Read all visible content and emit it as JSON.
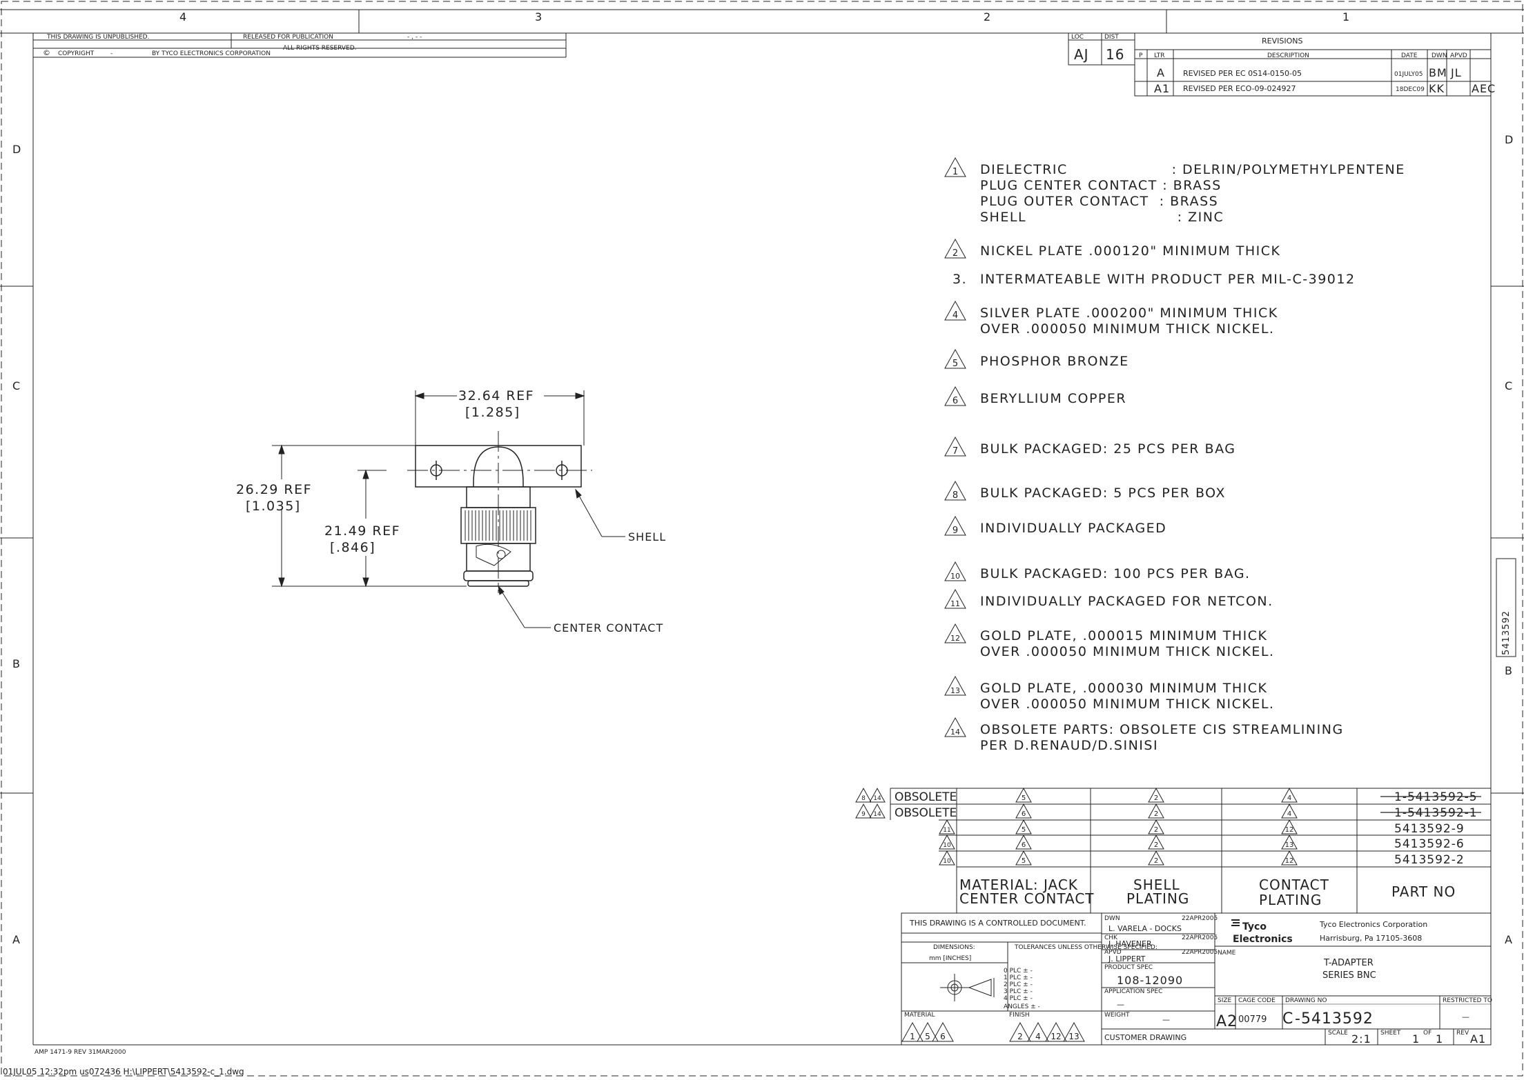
{
  "border": {
    "zones_top": [
      "4",
      "3",
      "2",
      "1"
    ],
    "zones_side": [
      "D",
      "C",
      "B",
      "A"
    ],
    "side_tab": "5413592"
  },
  "header": {
    "unpublished": "THIS DRAWING IS UNPUBLISHED.",
    "released": "RELEASED FOR PUBLICATION",
    "released_value": "- , -  -",
    "copyright_sym": "©",
    "copyright": "COPYRIGHT",
    "copyright_dash": "-",
    "by": "BY TYCO ELECTRONICS CORPORATION",
    "rights": "ALL RIGHTS RESERVED."
  },
  "loc_dist": {
    "loc_label": "LOC",
    "loc_value": "AJ",
    "dist_label": "DIST",
    "dist_value": "16"
  },
  "revisions": {
    "title": "REVISIONS",
    "headers": [
      "P",
      "LTR",
      "DESCRIPTION",
      "DATE",
      "DWN",
      "APVD"
    ],
    "rows": [
      {
        "ltr": "A",
        "desc": "REVISED PER EC 0S14-0150-05",
        "date": "01JULY05",
        "dwn": "BM",
        "apvd": "JL"
      },
      {
        "ltr": "A1",
        "desc": "REVISED PER ECO-09-024927",
        "date": "18DEC09",
        "dwn": "KK",
        "apvd": "AEC"
      }
    ]
  },
  "notes": [
    {
      "num": "1",
      "tri": true,
      "lines": [
        "DIELECTRIC                    : DELRIN/POLYMETHYLPENTENE",
        "PLUG CENTER CONTACT : BRASS",
        "PLUG OUTER CONTACT  : BRASS",
        "SHELL                             : ZINC"
      ]
    },
    {
      "num": "2",
      "tri": true,
      "lines": [
        "NICKEL PLATE .000120\" MINIMUM THICK"
      ]
    },
    {
      "num": "3.",
      "tri": false,
      "lines": [
        "INTERMATEABLE WITH PRODUCT PER MIL-C-39012"
      ]
    },
    {
      "num": "4",
      "tri": true,
      "lines": [
        "SILVER PLATE .000200\" MINIMUM THICK",
        "OVER .000050 MINIMUM THICK NICKEL."
      ]
    },
    {
      "num": "5",
      "tri": true,
      "lines": [
        "PHOSPHOR BRONZE"
      ]
    },
    {
      "num": "6",
      "tri": true,
      "lines": [
        "BERYLLIUM COPPER"
      ]
    },
    {
      "num": "7",
      "tri": true,
      "lines": [
        "BULK PACKAGED: 25 PCS PER BAG"
      ]
    },
    {
      "num": "8",
      "tri": true,
      "lines": [
        "BULK PACKAGED: 5 PCS PER BOX"
      ]
    },
    {
      "num": "9",
      "tri": true,
      "lines": [
        "INDIVIDUALLY PACKAGED"
      ]
    },
    {
      "num": "10",
      "tri": true,
      "lines": [
        "BULK PACKAGED: 100 PCS PER BAG."
      ]
    },
    {
      "num": "11",
      "tri": true,
      "lines": [
        "INDIVIDUALLY PACKAGED FOR NETCON."
      ]
    },
    {
      "num": "12",
      "tri": true,
      "lines": [
        "GOLD PLATE, .000015 MINIMUM THICK",
        "OVER .000050 MINIMUM THICK NICKEL."
      ]
    },
    {
      "num": "13",
      "tri": true,
      "lines": [
        "GOLD PLATE, .000030 MINIMUM THICK",
        "OVER .000050 MINIMUM THICK NICKEL."
      ]
    },
    {
      "num": "14",
      "tri": true,
      "lines": [
        "OBSOLETE PARTS: OBSOLETE CIS STREAMLINING",
        "PER D.RENAUD/D.SINISI"
      ]
    }
  ],
  "drawing": {
    "width_dim": "32.64 REF",
    "width_dim_in": "[1.285]",
    "height_dim": "26.29 REF",
    "height_dim_in": "[1.035]",
    "height2_dim": "21.49 REF",
    "height2_dim_in": "[.846]",
    "shell_label": "SHELL",
    "center_label": "CENTER CONTACT"
  },
  "parts_table": {
    "headers": [
      "MATERIAL: JACK",
      "CENTER CONTACT",
      "SHELL",
      "PLATING",
      "CONTACT",
      "PLATING",
      "PART NO"
    ],
    "rows": [
      {
        "tags": [
          "8",
          "14"
        ],
        "label": "OBSOLETE",
        "mat": "5",
        "shell": "2",
        "plating": "4",
        "part": "1-5413592-5",
        "obsolete": true
      },
      {
        "tags": [
          "9",
          "14"
        ],
        "label": "OBSOLETE",
        "mat": "6",
        "shell": "2",
        "plating": "4",
        "part": "1-5413592-1",
        "obsolete": true
      },
      {
        "tags": [
          "11"
        ],
        "label": "",
        "mat": "5",
        "shell": "2",
        "plating": "12",
        "part": "5413592-9",
        "obsolete": false
      },
      {
        "tags": [
          "10"
        ],
        "label": "",
        "mat": "6",
        "shell": "2",
        "plating": "13",
        "part": "5413592-6",
        "obsolete": false
      },
      {
        "tags": [
          "10"
        ],
        "label": "",
        "mat": "5",
        "shell": "2",
        "plating": "12",
        "part": "5413592-2",
        "obsolete": false
      }
    ]
  },
  "title_block": {
    "controlled": "THIS DRAWING IS A CONTROLLED DOCUMENT.",
    "dimensions": "DIMENSIONS:",
    "dim_units": "mm [INCHES]",
    "tolerances": "TOLERANCES UNLESS OTHERWISE SPECIFIED:",
    "tol_rows": [
      "0 PLC    ±  -",
      "1 PLC    ±  -",
      "2 PLC    ±  -",
      "3 PLC    ±  -",
      "4 PLC    ±  -",
      "ANGLES          ±  -"
    ],
    "material_label": "MATERIAL",
    "material_values": [
      "1",
      "5",
      "6"
    ],
    "finish_label": "FINISH",
    "finish_values": [
      "2",
      "4",
      "12",
      "13"
    ],
    "dwn_label": "DWN",
    "dwn_name": "L. VARELA - DOCKS",
    "dwn_date": "22APR2005",
    "chk_label": "CHK",
    "chk_name": "J. HAVENER",
    "chk_date": "22APR2005",
    "apvd_label": "APVD",
    "apvd_name": "J. LIPPERT",
    "apvd_date": "22APR2005",
    "product_spec_label": "PRODUCT SPEC",
    "product_spec": "108-12090",
    "app_spec_label": "APPLICATION SPEC",
    "app_spec": "—",
    "weight_label": "WEIGHT",
    "weight": "—",
    "customer": "CUSTOMER DRAWING",
    "logo_1": "Tyco",
    "logo_2": "Electronics",
    "company": "Tyco Electronics Corporation",
    "address": "Harrisburg, Pa 17105-3608",
    "name_label": "NAME",
    "name_1": "T-ADAPTER",
    "name_2": "SERIES BNC",
    "size_label": "SIZE",
    "size": "A2",
    "cage_label": "CAGE CODE",
    "cage": "00779",
    "dwg_label": "DRAWING NO",
    "dwg_prefix": "C",
    "dwg": "-5413592",
    "restricted_label": "RESTRICTED TO",
    "restricted": "—",
    "scale_label": "SCALE",
    "scale": "2:1",
    "sheet_label": "SHEET",
    "sheet": "1",
    "of_label": "OF",
    "of": "1",
    "rev_label": "REV",
    "rev": "A1"
  },
  "footer": {
    "form": "AMP 1471-9 REV 31MAR2000",
    "plot": "01JUL05    12:32pm    us072436    H:\\LIPPERT\\5413592-c_1.dwg"
  }
}
